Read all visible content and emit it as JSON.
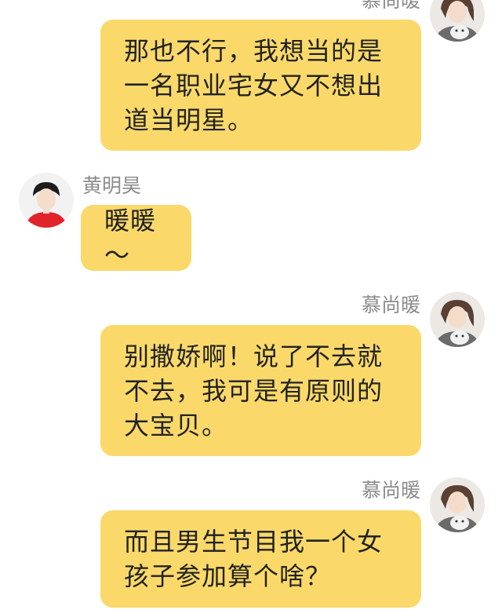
{
  "colors": {
    "bubble": "#fad96a",
    "name_text": "#8c8c8c",
    "message_text": "#222222",
    "background": "#ffffff"
  },
  "messages": [
    {
      "sender": "慕尚暖",
      "side": "right",
      "avatar_icon": "girl-with-cat-avatar-icon",
      "text": "那也不行，我想当的是\n一名职业宅女又不想出\n道当明星。"
    },
    {
      "sender": "黄明昊",
      "side": "left",
      "avatar_icon": "boy-red-shirt-avatar-icon",
      "text": "暖暖～"
    },
    {
      "sender": "慕尚暖",
      "side": "right",
      "avatar_icon": "girl-with-cat-avatar-icon",
      "text": "别撒娇啊！说了不去就\n不去，我可是有原则的\n大宝贝。"
    },
    {
      "sender": "慕尚暖",
      "side": "right",
      "avatar_icon": "girl-with-cat-avatar-icon",
      "text": "而且男生节目我一个女\n孩子参加算个啥？"
    }
  ]
}
